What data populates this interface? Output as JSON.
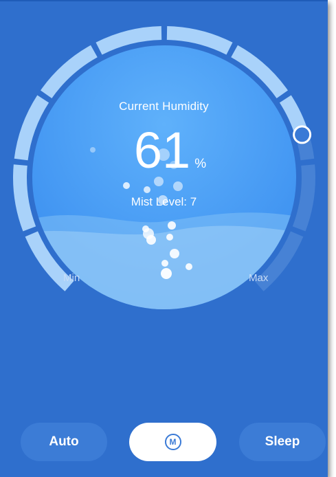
{
  "dial": {
    "title": "Current Humidity",
    "value": "61",
    "unit": "%",
    "mist_label": "Mist Level: 7",
    "min_label": "Min",
    "max_label": "Max",
    "level_fraction": 0.76
  },
  "modes": {
    "auto_label": "Auto",
    "manual_icon_letter": "M",
    "manual_icon": "manual-mode-icon",
    "sleep_label": "Sleep"
  },
  "colors": {
    "background": "#2f6fcd",
    "button_bg": "#3c7cd6",
    "accent": "#3a7ad6"
  }
}
